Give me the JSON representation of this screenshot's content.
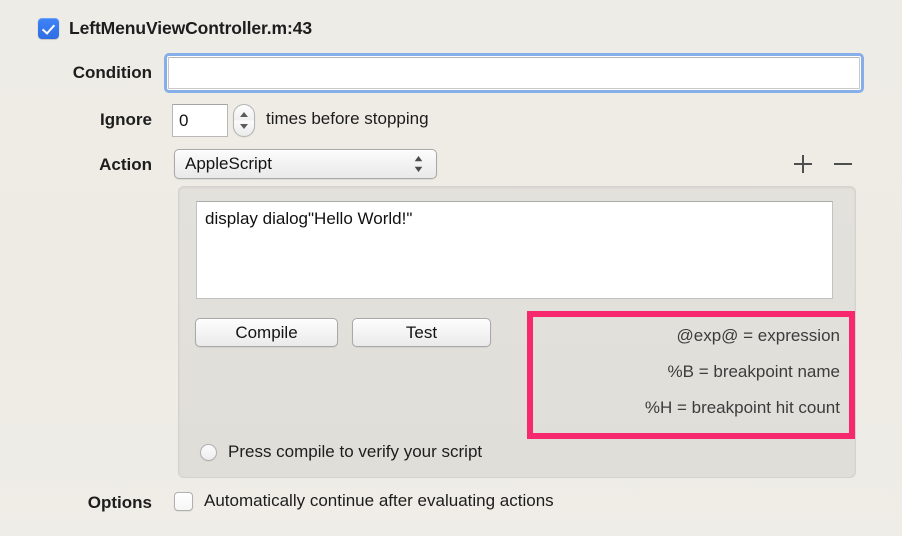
{
  "header": {
    "checkbox_checked": true,
    "title": "LeftMenuViewController.m:43"
  },
  "condition": {
    "label": "Condition",
    "value": "",
    "placeholder": ""
  },
  "ignore": {
    "label": "Ignore",
    "value": "0",
    "suffix": "times before stopping"
  },
  "action": {
    "label": "Action",
    "selected": "AppleScript",
    "add_icon": "plus-icon",
    "remove_icon": "minus-icon"
  },
  "script": {
    "value": "display dialog\"Hello World!\"",
    "compile_label": "Compile",
    "test_label": "Test",
    "status": "Press compile to verify your script"
  },
  "legend": {
    "highlight_color": "#f8286e",
    "lines": [
      "@exp@ = expression",
      "%B = breakpoint name",
      "%H = breakpoint hit count"
    ]
  },
  "options": {
    "label": "Options",
    "checkbox_checked": false,
    "text": "Automatically continue after evaluating actions"
  },
  "colors": {
    "background": "#edebe4",
    "accent_blue": "#3478f6",
    "highlight_pink": "#f8286e"
  }
}
